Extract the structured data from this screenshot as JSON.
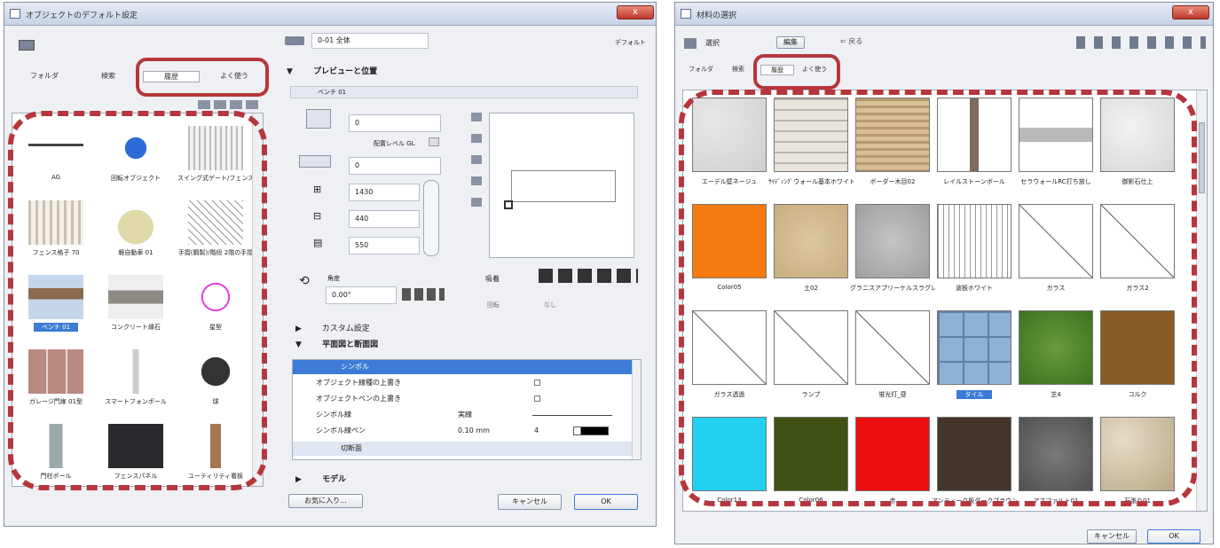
{
  "left_window": {
    "title": "オブジェクトのデフォルト設定",
    "close_label": "x",
    "tabs": [
      "フォルダ",
      "検索",
      "履歴",
      "よく使う"
    ],
    "objects": [
      {
        "label": "AG"
      },
      {
        "label": "回転オブジェクト"
      },
      {
        "label": "スイング式ゲート/フェンス"
      },
      {
        "label": "フェンス格子 70"
      },
      {
        "label": "軽自動車 01"
      },
      {
        "label": "手摺(鋼製)/階段 2階の手摺"
      },
      {
        "label": "ベンチ 01",
        "selected": true
      },
      {
        "label": "コンクリート縁石"
      },
      {
        "label": "星型"
      },
      {
        "label": "ガレージ門扉 01型"
      },
      {
        "label": "スマートフォンポール"
      },
      {
        "label": "球"
      },
      {
        "label": "門柱ポール"
      },
      {
        "label": "フェンスパネル"
      },
      {
        "label": "ユーティリティ看板"
      }
    ],
    "layer_value": "0-01 全体",
    "default_label": "デフォルト",
    "preview_section": "プレビューと位置",
    "object_name": "ベンチ 01",
    "elev_value1": "0",
    "elev_ref_label": "配置レベル GL",
    "elev_value2": "0",
    "width_value": "1430",
    "depth_value": "440",
    "height_value": "550",
    "angle_label": "角度",
    "angle_value": "0.00°",
    "anchor_label": "吸着",
    "opt_label": "回転",
    "opt_none": "なし",
    "custom_section": "カスタム設定",
    "plan_section": "平面図と断面図",
    "symbol_header": "シンボル",
    "symbol_rows": [
      {
        "label": "オブジェクト線種の上書き",
        "val": "",
        "val2": ""
      },
      {
        "label": "オブジェクトペンの上書き",
        "val": "",
        "val2": ""
      },
      {
        "label": "シンボル線",
        "val": "実線",
        "val2": ""
      },
      {
        "label": "シンボル線ペン",
        "val": "0.10 mm",
        "val2": "4"
      }
    ],
    "section_header": "切断面",
    "model_section": "モデル",
    "favorite_btn": "お気に入り...",
    "cancel_btn": "キャンセル",
    "ok_btn": "OK"
  },
  "right_window": {
    "title": "材料の選択",
    "close_label": "x",
    "view_label": "選択",
    "edit_btn": "編集",
    "back_label": "戻る",
    "tabs": [
      "フォルダ",
      "検索",
      "履歴",
      "よく使う"
    ],
    "materials": [
      {
        "label": "エーデル壁ネージュ",
        "kind": "plaster"
      },
      {
        "label": "ｻｲﾃﾞｨﾝｸﾞウォール基本ホワイト",
        "kind": "brick"
      },
      {
        "label": "ボーダー木目02",
        "kind": "wood"
      },
      {
        "label": "レイルストーンボール",
        "kind": "column"
      },
      {
        "label": "セラウォールRC打ち放し",
        "kind": "bar"
      },
      {
        "label": "御影石仕上",
        "kind": "stone"
      },
      {
        "label": "Color05",
        "kind": "orange"
      },
      {
        "label": "土02",
        "kind": "sand"
      },
      {
        "label": "グラニスアプリーケルスラグレー12060",
        "kind": "granite"
      },
      {
        "label": "波板ホワイト",
        "kind": "stripes"
      },
      {
        "label": "ガラス",
        "kind": "diag"
      },
      {
        "label": "ガラス2",
        "kind": "diag"
      },
      {
        "label": "ガラス透過",
        "kind": "diag"
      },
      {
        "label": "ランプ",
        "kind": "diag"
      },
      {
        "label": "蛍光灯_昼",
        "kind": "diag"
      },
      {
        "label": "タイル",
        "kind": "tile",
        "selected": true
      },
      {
        "label": "芝4",
        "kind": "grass"
      },
      {
        "label": "コルク",
        "kind": "brown"
      },
      {
        "label": "Color13",
        "kind": "cyan"
      },
      {
        "label": "Color06",
        "kind": "olive"
      },
      {
        "label": "赤",
        "kind": "red"
      },
      {
        "label": "アンティーク板ダークブラウン",
        "kind": "darkwood"
      },
      {
        "label": "アスファルト01",
        "kind": "asphalt"
      },
      {
        "label": "石張り01",
        "kind": "cobble"
      }
    ],
    "cancel_btn": "キャンセル",
    "ok_btn": "OK"
  },
  "colors": {
    "highlight": "#b5373b",
    "selection": "#3c7bd6",
    "titlebar": "#c7d3e6"
  }
}
